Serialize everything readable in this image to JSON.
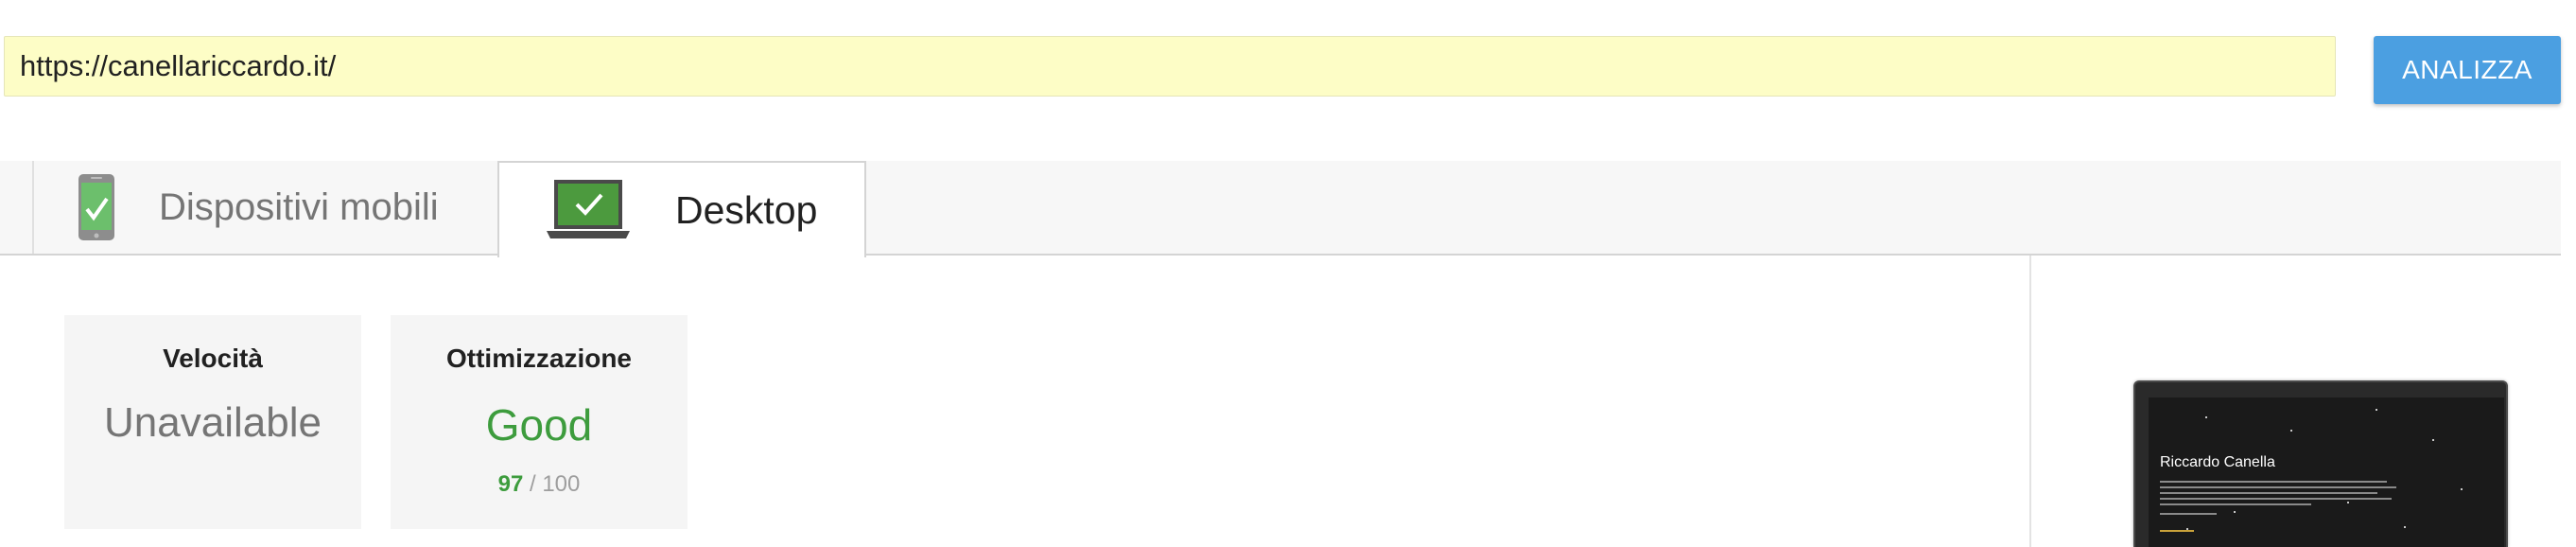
{
  "url_bar": {
    "value": "https://canellariccardo.it/"
  },
  "analyze_button": {
    "label": "ANALIZZA"
  },
  "tabs": [
    {
      "label": "Dispositivi mobili",
      "icon": "phone-check-icon",
      "selected": false
    },
    {
      "label": "Desktop",
      "icon": "laptop-check-icon",
      "selected": true
    }
  ],
  "cards": {
    "speed": {
      "title": "Velocità",
      "value": "Unavailable"
    },
    "optimization": {
      "title": "Ottimizzazione",
      "value": "Good",
      "score": "97",
      "score_total": "/ 100"
    }
  },
  "preview": {
    "site_title": "Riccardo Canella"
  },
  "colors": {
    "accent": "#4b9fe1",
    "good": "#3d9c3d",
    "url_bg": "#fdfdc6"
  }
}
